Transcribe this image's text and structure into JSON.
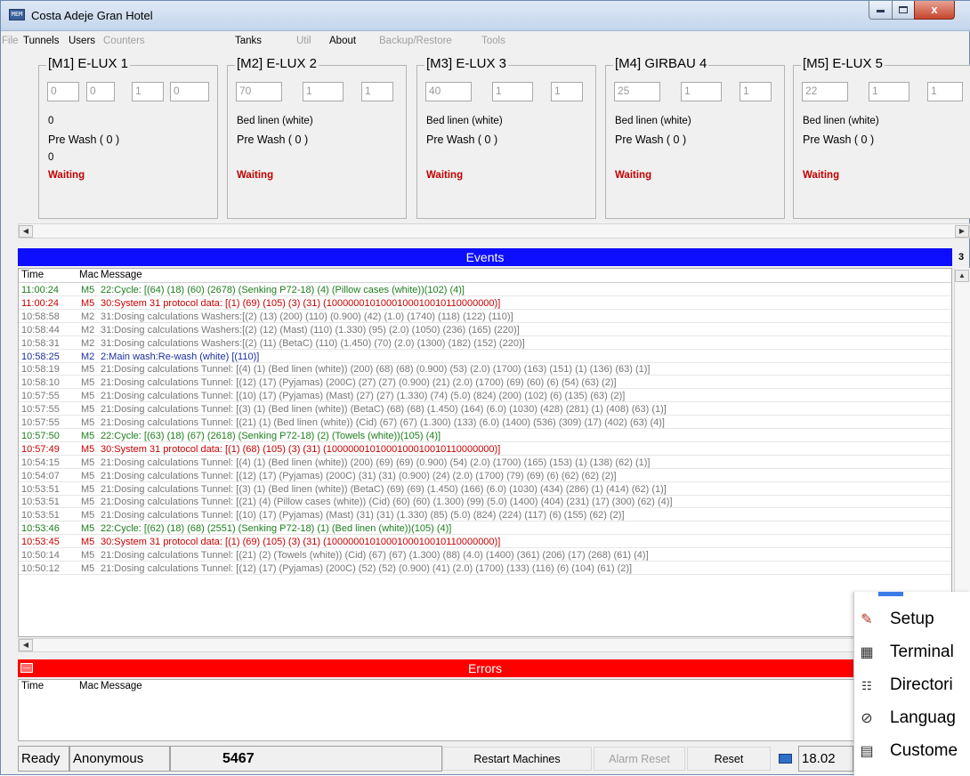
{
  "window": {
    "title": "Costa Adeje Gran Hotel",
    "app_icon_text": "MEM",
    "close_glyph": "x"
  },
  "menu": [
    {
      "label": "File",
      "enabled": false
    },
    {
      "label": "Tunnels",
      "enabled": true
    },
    {
      "label": "Users",
      "enabled": true
    },
    {
      "label": "Counters",
      "enabled": false
    },
    {
      "label": "Tanks",
      "enabled": true
    },
    {
      "label": "Util",
      "enabled": false
    },
    {
      "label": "About",
      "enabled": true
    },
    {
      "label": "Backup/Restore",
      "enabled": false
    },
    {
      "label": "Tools",
      "enabled": false
    }
  ],
  "machines": [
    {
      "title": "[M1] E-LUX 1",
      "inputs": [
        "0",
        "0",
        "1",
        "0"
      ],
      "line1": "0",
      "line2": "Pre Wash ( 0 )",
      "line3": "0",
      "status": "Waiting"
    },
    {
      "title": "[M2] E-LUX 2",
      "inputs": [
        "70",
        "1",
        "1",
        ""
      ],
      "line1": "Bed linen (white)",
      "line2": "Pre Wash ( 0 )",
      "line3": "",
      "status": "Waiting"
    },
    {
      "title": "[M3] E-LUX 3",
      "inputs": [
        "40",
        "1",
        "1",
        ""
      ],
      "line1": "Bed linen (white)",
      "line2": "Pre Wash ( 0 )",
      "line3": "",
      "status": "Waiting"
    },
    {
      "title": "[M4] GIRBAU 4",
      "inputs": [
        "25",
        "1",
        "1",
        ""
      ],
      "line1": "Bed linen (white)",
      "line2": "Pre Wash ( 0 )",
      "line3": "",
      "status": "Waiting"
    },
    {
      "title": "[M5] E-LUX 5",
      "inputs": [
        "22",
        "1",
        "1",
        ""
      ],
      "line1": "Bed linen (white)",
      "line2": "Pre Wash ( 0 )",
      "line3": "",
      "status": "Waiting"
    }
  ],
  "events": {
    "title": "Events",
    "badge": "3",
    "col_time": "Time",
    "col_mac": "Mac",
    "col_msg": "Message",
    "rows": [
      {
        "time": "11:00:24",
        "mac": "M5",
        "msg": "22:Cycle: [(64) (18) (60) (2678) (Senking P72-18) (4) (Pillow cases (white))(102) (4)]",
        "color": "green"
      },
      {
        "time": "11:00:24",
        "mac": "M5",
        "msg": "30:System 31 protocol data: [(1) (69) (105) (3) (31) (1000000101000100010010110000000)]",
        "color": "red"
      },
      {
        "time": "10:58:58",
        "mac": "M2",
        "msg": "31:Dosing calculations Washers:[(2) (13) (200) (110) (0.900) (42) (1.0) (1740) (118) (122) (110)]",
        "color": "gray"
      },
      {
        "time": "10:58:44",
        "mac": "M2",
        "msg": "31:Dosing calculations Washers:[(2) (12) (Mast) (110) (1.330) (95) (2.0) (1050) (236) (165) (220)]",
        "color": "gray"
      },
      {
        "time": "10:58:31",
        "mac": "M2",
        "msg": "31:Dosing calculations Washers:[(2) (11) (BetaC) (110) (1.450) (70) (2.0) (1300) (182) (152) (220)]",
        "color": "gray"
      },
      {
        "time": "10:58:25",
        "mac": "M2",
        "msg": "2:Main wash:Re-wash (white) [(110)]",
        "color": "blue"
      },
      {
        "time": "10:58:19",
        "mac": "M5",
        "msg": "21:Dosing calculations Tunnel: [(4) (1) (Bed linen (white)) (200) (68) (68) (0.900) (53) (2.0) (1700) (163) (151) (1) (136) (63) (1)]",
        "color": "gray"
      },
      {
        "time": "10:58:10",
        "mac": "M5",
        "msg": "21:Dosing calculations Tunnel: [(12) (17) (Pyjamas) (200C) (27) (27) (0.900) (21) (2.0) (1700) (69) (60) (6) (54) (63) (2)]",
        "color": "gray"
      },
      {
        "time": "10:57:55",
        "mac": "M5",
        "msg": "21:Dosing calculations Tunnel: [(10) (17) (Pyjamas) (Mast) (27) (27) (1.330) (74) (5.0) (824) (200) (102) (6) (135) (63) (2)]",
        "color": "gray"
      },
      {
        "time": "10:57:55",
        "mac": "M5",
        "msg": "21:Dosing calculations Tunnel: [(3) (1) (Bed linen (white)) (BetaC) (68) (68) (1.450) (164) (6.0) (1030) (428) (281) (1) (408) (63) (1)]",
        "color": "gray"
      },
      {
        "time": "10:57:55",
        "mac": "M5",
        "msg": "21:Dosing calculations Tunnel: [(21) (1) (Bed linen (white)) (Cid) (67) (67) (1.300) (133) (6.0) (1400) (536) (309) (17) (402) (63) (4)]",
        "color": "gray"
      },
      {
        "time": "10:57:50",
        "mac": "M5",
        "msg": "22:Cycle: [(63) (18) (67) (2618) (Senking P72-18) (2) (Towels (white))(105) (4)]",
        "color": "green"
      },
      {
        "time": "10:57:49",
        "mac": "M5",
        "msg": "30:System 31 protocol data: [(1) (68) (105) (3) (31) (1000000101000100010010110000000)]",
        "color": "red"
      },
      {
        "time": "10:54:15",
        "mac": "M5",
        "msg": "21:Dosing calculations Tunnel: [(4) (1) (Bed linen (white)) (200) (69) (69) (0.900) (54) (2.0) (1700) (165) (153) (1) (138) (62) (1)]",
        "color": "gray"
      },
      {
        "time": "10:54:07",
        "mac": "M5",
        "msg": "21:Dosing calculations Tunnel: [(12) (17) (Pyjamas) (200C) (31) (31) (0.900) (24) (2.0) (1700) (79) (69) (6) (62) (62) (2)]",
        "color": "gray"
      },
      {
        "time": "10:53:51",
        "mac": "M5",
        "msg": "21:Dosing calculations Tunnel: [(3) (1) (Bed linen (white)) (BetaC) (69) (69) (1.450) (166) (6.0) (1030) (434) (286) (1) (414) (62) (1)]",
        "color": "gray"
      },
      {
        "time": "10:53:51",
        "mac": "M5",
        "msg": "21:Dosing calculations Tunnel: [(21) (4) (Pillow cases (white)) (Cid) (60) (60) (1.300) (99) (5.0) (1400) (404) (231) (17) (300) (62) (4)]",
        "color": "gray"
      },
      {
        "time": "10:53:51",
        "mac": "M5",
        "msg": "21:Dosing calculations Tunnel: [(10) (17) (Pyjamas) (Mast) (31) (31) (1.330) (85) (5.0) (824) (224) (117) (6) (155) (62) (2)]",
        "color": "gray"
      },
      {
        "time": "10:53:46",
        "mac": "M5",
        "msg": "22:Cycle: [(62) (18) (68) (2551) (Senking P72-18) (1) (Bed linen (white))(105) (4)]",
        "color": "green"
      },
      {
        "time": "10:53:45",
        "mac": "M5",
        "msg": "30:System 31 protocol data: [(1) (69) (105) (3) (31) (1000000101000100010010110000000)]",
        "color": "red"
      },
      {
        "time": "10:50:14",
        "mac": "M5",
        "msg": "21:Dosing calculations Tunnel: [(21) (2) (Towels (white)) (Cid) (67) (67) (1.300) (88) (4.0) (1400) (361) (206) (17) (268) (61) (4)]",
        "color": "gray"
      },
      {
        "time": "10:50:12",
        "mac": "M5",
        "msg": "21:Dosing calculations Tunnel: [(12) (17) (Pyjamas) (200C) (52) (52) (0.900) (41) (2.0) (1700) (133) (116) (6) (104) (61) (2)]",
        "color": "gray"
      }
    ]
  },
  "errors": {
    "title": "Errors",
    "col_time": "Time",
    "col_mac": "Mac",
    "col_msg": "Message"
  },
  "status": {
    "ready": "Ready",
    "user": "Anonymous",
    "count": "5467",
    "restart": "Restart Machines",
    "alarm_reset": "Alarm Reset",
    "reset": "Reset",
    "version": "18.02"
  },
  "context_menu": [
    {
      "label": "Setup",
      "icon": "wrench-icon"
    },
    {
      "label": "Terminal",
      "icon": "calculator-icon"
    },
    {
      "label": "Directori",
      "icon": "directory-icon"
    },
    {
      "label": "Languag",
      "icon": "language-icon"
    },
    {
      "label": "Custome",
      "icon": "customer-icon"
    }
  ]
}
